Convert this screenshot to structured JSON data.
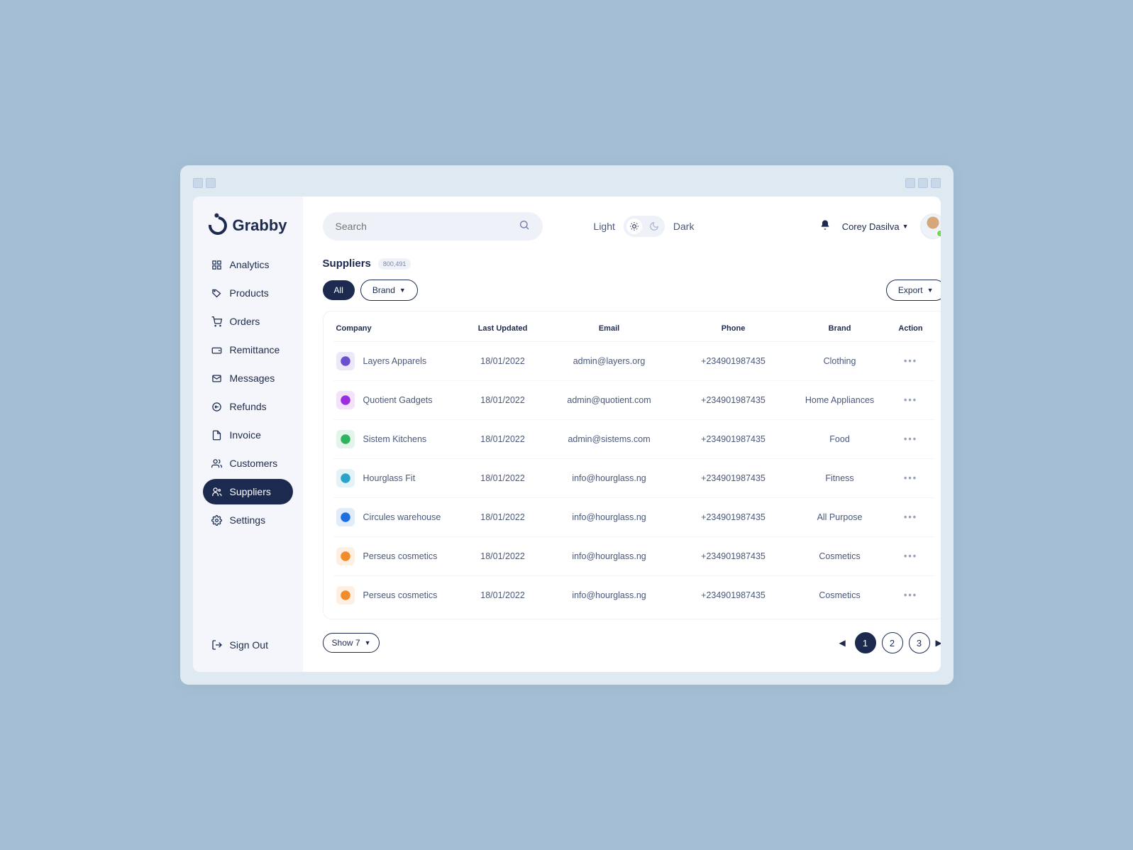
{
  "app_name": "Grabby",
  "search": {
    "placeholder": "Search"
  },
  "theme": {
    "light_label": "Light",
    "dark_label": "Dark",
    "mode": "light"
  },
  "user": {
    "name": "Corey Dasilva"
  },
  "sidebar": {
    "items": [
      {
        "label": "Analytics",
        "icon": "grid-icon"
      },
      {
        "label": "Products",
        "icon": "tag-icon"
      },
      {
        "label": "Orders",
        "icon": "cart-icon"
      },
      {
        "label": "Remittance",
        "icon": "wallet-icon"
      },
      {
        "label": "Messages",
        "icon": "mail-icon"
      },
      {
        "label": "Refunds",
        "icon": "refund-icon"
      },
      {
        "label": "Invoice",
        "icon": "file-icon"
      },
      {
        "label": "Customers",
        "icon": "users-icon"
      },
      {
        "label": "Suppliers",
        "icon": "suppliers-icon",
        "active": true
      },
      {
        "label": "Settings",
        "icon": "gear-icon"
      }
    ],
    "signout_label": "Sign Out"
  },
  "page": {
    "title": "Suppliers",
    "count_badge": "800,491",
    "filters": {
      "all": "All",
      "brand": "Brand"
    },
    "export_label": "Export",
    "columns": [
      "Company",
      "Last Updated",
      "Email",
      "Phone",
      "Brand",
      "Action"
    ],
    "rows": [
      {
        "company": "Layers Apparels",
        "logo_color": "#6b4fce",
        "updated": "18/01/2022",
        "email": "admin@layers.org",
        "phone": "+234901987435",
        "brand": "Clothing"
      },
      {
        "company": "Quotient Gadgets",
        "logo_color": "#9b2fe0",
        "updated": "18/01/2022",
        "email": "admin@quotient.com",
        "phone": "+234901987435",
        "brand": "Home Appliances"
      },
      {
        "company": "Sistem Kitchens",
        "logo_color": "#2fb35f",
        "updated": "18/01/2022",
        "email": "admin@sistems.com",
        "phone": "+234901987435",
        "brand": "Food"
      },
      {
        "company": "Hourglass Fit",
        "logo_color": "#2aa5c9",
        "updated": "18/01/2022",
        "email": "info@hourglass.ng",
        "phone": "+234901987435",
        "brand": "Fitness"
      },
      {
        "company": "Circules warehouse",
        "logo_color": "#1f6fe0",
        "updated": "18/01/2022",
        "email": "info@hourglass.ng",
        "phone": "+234901987435",
        "brand": "All Purpose"
      },
      {
        "company": "Perseus cosmetics",
        "logo_color": "#f08c2a",
        "updated": "18/01/2022",
        "email": "info@hourglass.ng",
        "phone": "+234901987435",
        "brand": "Cosmetics"
      },
      {
        "company": "Perseus cosmetics",
        "logo_color": "#f08c2a",
        "updated": "18/01/2022",
        "email": "info@hourglass.ng",
        "phone": "+234901987435",
        "brand": "Cosmetics"
      }
    ],
    "show_label": "Show 7",
    "pages": [
      "1",
      "2",
      "3"
    ],
    "active_page": "1"
  }
}
